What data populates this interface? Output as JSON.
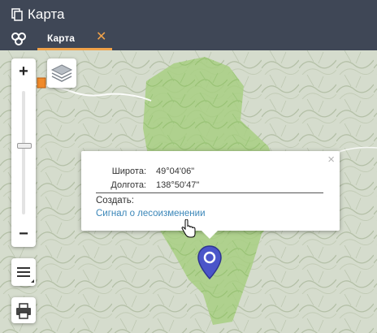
{
  "window": {
    "title": "Карта",
    "icon": "window-copy-icon"
  },
  "tabs": [
    {
      "label": "Карта",
      "close_label": "✕"
    }
  ],
  "map_controls": {
    "zoom_in_label": "+",
    "zoom_out_label": "−",
    "layers_icon": "layers-icon",
    "menu_icon": "hamburger-menu-icon",
    "print_icon": "printer-icon"
  },
  "popup": {
    "close_label": "×",
    "latitude_label": "Широта:",
    "latitude_value": "49°04'06\"",
    "longitude_label": "Долгота:",
    "longitude_value": "138°50'47\"",
    "create_label": "Создать:",
    "signal_link": "Сигнал о лесоизменении"
  },
  "colors": {
    "titlebar_bg": "#3f4756",
    "tab_accent": "#f0a24a",
    "link": "#3a86b8",
    "marker": "#4b55c9",
    "region_fill": "#a8cf82"
  }
}
